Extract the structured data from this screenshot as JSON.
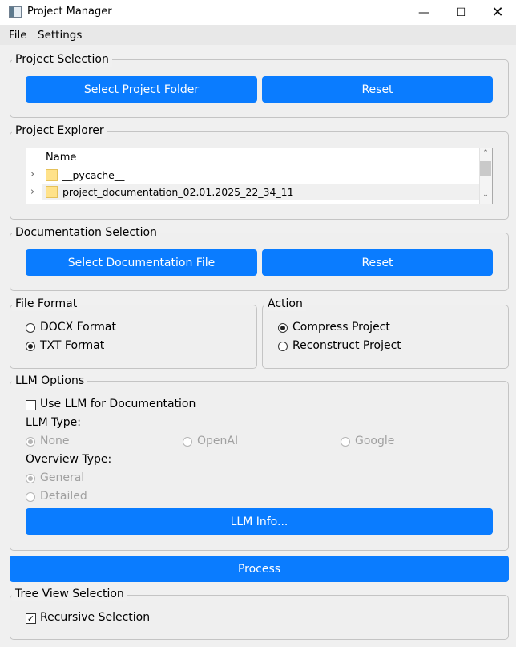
{
  "window": {
    "title": "Project Manager",
    "minimize_icon": "minimize-icon",
    "maximize_icon": "maximize-icon",
    "close_icon": "close-icon"
  },
  "menubar": {
    "file": "File",
    "settings": "Settings"
  },
  "project_selection": {
    "title": "Project Selection",
    "select_button": "Select Project Folder",
    "reset_button": "Reset"
  },
  "project_explorer": {
    "title": "Project Explorer",
    "column_name": "Name",
    "items": [
      {
        "label": "__pycache__",
        "icon": "folder-icon"
      },
      {
        "label": "project_documentation_02.01.2025_22_34_11",
        "icon": "folder-icon"
      }
    ]
  },
  "documentation_selection": {
    "title": "Documentation Selection",
    "select_button": "Select Documentation File",
    "reset_button": "Reset"
  },
  "file_format": {
    "title": "File Format",
    "options": [
      {
        "label": "DOCX Format",
        "selected": false
      },
      {
        "label": "TXT Format",
        "selected": true
      }
    ]
  },
  "action": {
    "title": "Action",
    "options": [
      {
        "label": "Compress Project",
        "selected": true
      },
      {
        "label": "Reconstruct Project",
        "selected": false
      }
    ]
  },
  "llm_options": {
    "title": "LLM Options",
    "use_llm_label": "Use LLM for Documentation",
    "use_llm_checked": false,
    "llm_type_label": "LLM Type:",
    "llm_types": [
      {
        "label": "None",
        "selected": true
      },
      {
        "label": "OpenAI",
        "selected": false
      },
      {
        "label": "Google",
        "selected": false
      }
    ],
    "overview_type_label": "Overview Type:",
    "overview_types": [
      {
        "label": "General",
        "selected": true
      },
      {
        "label": "Detailed",
        "selected": false
      }
    ],
    "info_button": "LLM Info..."
  },
  "process_button": "Process",
  "tree_view_selection": {
    "title": "Tree View Selection",
    "recursive_label": "Recursive Selection",
    "recursive_checked": true
  },
  "colors": {
    "accent": "#0a7cff",
    "background": "#f0f0f0"
  }
}
